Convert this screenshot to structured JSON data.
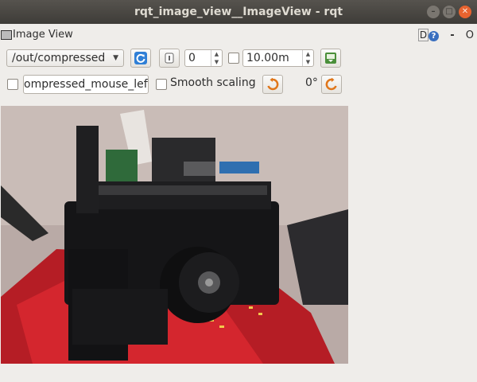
{
  "window": {
    "title": "rqt_image_view__ImageView - rqt",
    "controls": {
      "minimize": "–",
      "maximize": "□",
      "close": "✕"
    }
  },
  "dock": {
    "title": "Image View",
    "right_d": "D",
    "right_help": "?",
    "right_dash": "-",
    "right_o": "O"
  },
  "toolbar": {
    "topic": "/out/compressed",
    "refresh_icon": "refresh-icon",
    "num_spin": "0",
    "max_range": "10.00m",
    "save_icon": "save-icon"
  },
  "options": {
    "mouse_topic": "ompressed_mouse_left",
    "smooth_label": "Smooth scaling",
    "rotation": "0°",
    "rotate_left_icon": "rotate-left-icon",
    "rotate_right_icon": "rotate-right-icon"
  },
  "colors": {
    "titlebar": "#3e3c38",
    "window_bg": "#efedea",
    "accent_blue": "#2f7fd6",
    "accent_orange": "#e0761a",
    "book_red": "#c5222a"
  }
}
